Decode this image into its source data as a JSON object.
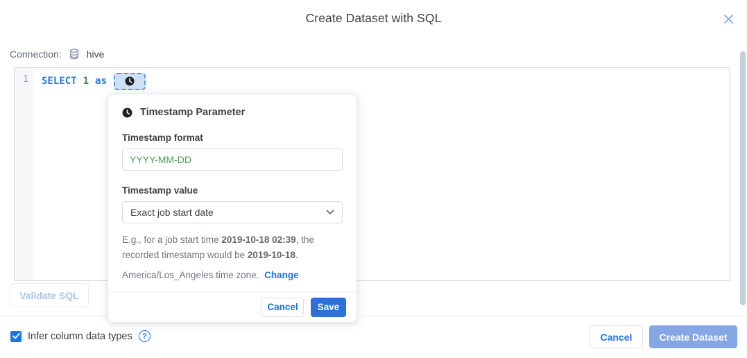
{
  "dialog": {
    "title": "Create Dataset with SQL"
  },
  "connection": {
    "label": "Connection:",
    "icon": "database-icon",
    "value": "hive"
  },
  "editor": {
    "line_number": "1",
    "sql": {
      "keyword_select": "SELECT",
      "number_literal": "1",
      "keyword_as": "as"
    },
    "parameter_chip_icon": "clock-icon"
  },
  "popover": {
    "icon": "clock-icon",
    "title": "Timestamp Parameter",
    "format_label": "Timestamp format",
    "format_value": "YYYY-MM-DD",
    "value_label": "Timestamp value",
    "value_selected": "Exact job start date",
    "help": {
      "part1": "E.g., for a job start time ",
      "bold1": "2019-10-18 02:39",
      "part2": ", the recorded timestamp would be ",
      "bold2": "2019-10-18",
      "part3": "."
    },
    "timezone_text": "America/Los_Angeles time zone.",
    "change_link": "Change",
    "cancel_label": "Cancel",
    "save_label": "Save"
  },
  "toolbar": {
    "validate_label": "Validate SQL"
  },
  "footer": {
    "infer_checkbox": {
      "checked": true,
      "label": "Infer column data types"
    },
    "cancel_label": "Cancel",
    "create_label": "Create Dataset"
  },
  "colors": {
    "accent": "#1a73e8",
    "save_button_bg": "#2e6fd9",
    "create_button_disabled_bg": "#85a7e3",
    "sql_keyword": "#2979d9",
    "sql_number": "#3e9142",
    "format_value_text": "#4c9b57",
    "chip_bg": "#cfe1f7",
    "chip_border": "#5a97ea",
    "validate_disabled_text": "#aac4ee"
  }
}
